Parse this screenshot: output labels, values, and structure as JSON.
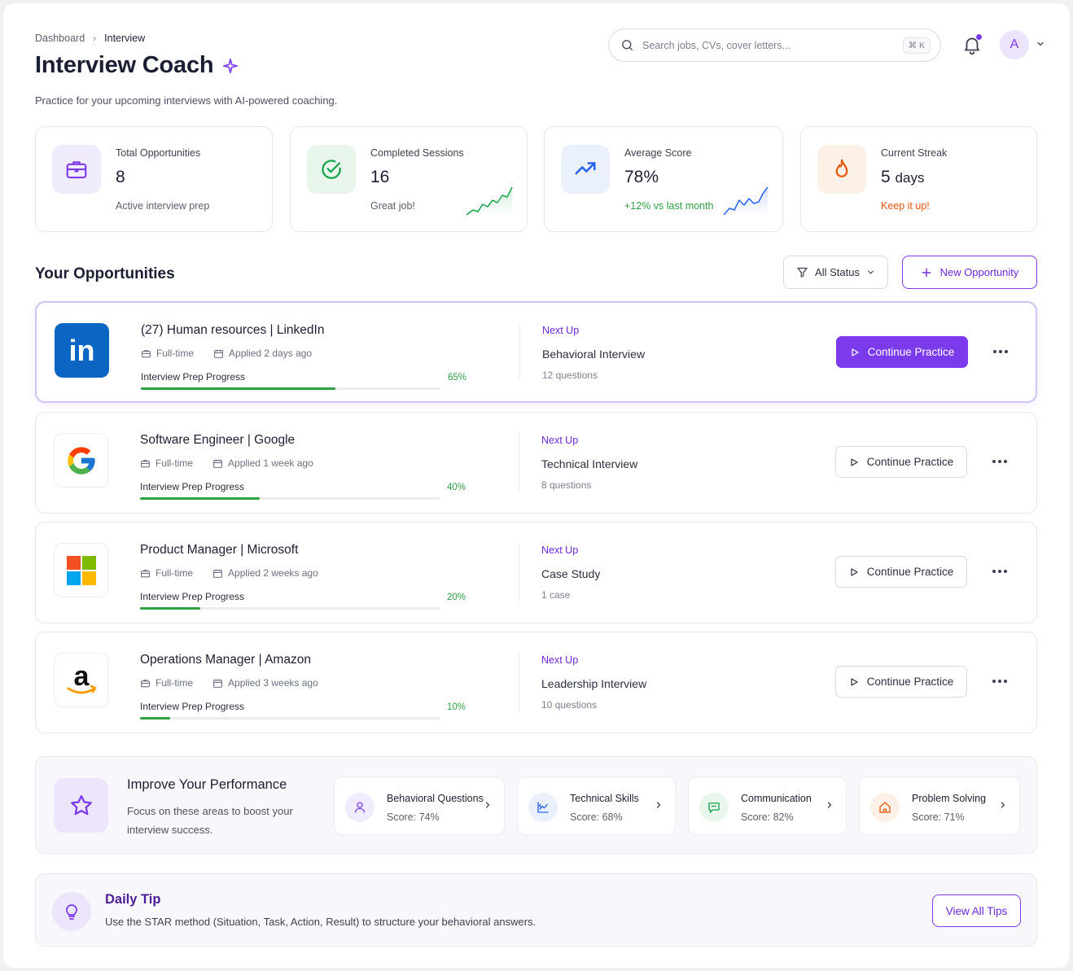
{
  "breadcrumb": {
    "root": "Dashboard",
    "separator": "›",
    "current": "Interview"
  },
  "header": {
    "title": "Interview Coach",
    "subtitle": "Practice for your upcoming interviews with AI-powered coaching.",
    "search_placeholder": "Search jobs, CVs, cover letters...",
    "search_shortcut": "⌘ K",
    "avatar_initial": "A"
  },
  "stats": [
    {
      "label": "Total Opportunities",
      "value": "8",
      "note": "Active interview prep",
      "icon": "briefcase-icon",
      "color": "#7c3aed"
    },
    {
      "label": "Completed Sessions",
      "value": "16",
      "note": "Great job!",
      "icon": "check-circle-icon",
      "color": "#16a34a"
    },
    {
      "label": "Average Score",
      "value": "78%",
      "note": "+12% vs last month",
      "icon": "trending-up-icon",
      "color": "#2563eb"
    },
    {
      "label": "Current Streak",
      "value": "5",
      "value_unit": "days",
      "note": "Keep it up!",
      "icon": "flame-icon",
      "color": "#ea580c"
    }
  ],
  "opportunities": {
    "title": "Your Opportunities",
    "filter_label": "All Status",
    "new_label": "New Opportunity",
    "continue_label": "Continue Practice",
    "next_label": "Next Up",
    "progress_label": "Interview Prep Progress",
    "items": [
      {
        "title": "(27) Human resources | LinkedIn",
        "type": "Full-time",
        "applied": "Applied 2 days ago",
        "progress": 65,
        "progress_text": "65%",
        "next": "Behavioral Interview",
        "count": "12 questions",
        "logo": "linkedin-logo"
      },
      {
        "title": "Software Engineer | Google",
        "type": "Full-time",
        "applied": "Applied 1 week ago",
        "progress": 40,
        "progress_text": "40%",
        "next": "Technical Interview",
        "count": "8 questions",
        "logo": "google-logo"
      },
      {
        "title": "Product Manager | Microsoft",
        "type": "Full-time",
        "applied": "Applied 2 weeks ago",
        "progress": 20,
        "progress_text": "20%",
        "next": "Case Study",
        "count": "1 case",
        "logo": "microsoft-logo"
      },
      {
        "title": "Operations Manager | Amazon",
        "type": "Full-time",
        "applied": "Applied 3 weeks ago",
        "progress": 10,
        "progress_text": "10%",
        "next": "Leadership Interview",
        "count": "10 questions",
        "logo": "amazon-logo"
      }
    ]
  },
  "improve": {
    "title": "Improve Your Performance",
    "description": "Focus on these areas to boost your interview success.",
    "areas": [
      {
        "name": "Behavioral Questions",
        "score": "Score: 74%",
        "icon": "person-icon",
        "color": "#7c3aed"
      },
      {
        "name": "Technical Skills",
        "score": "Score: 68%",
        "icon": "code-chart-icon",
        "color": "#2563eb"
      },
      {
        "name": "Communication",
        "score": "Score: 82%",
        "icon": "chat-icon",
        "color": "#16a34a"
      },
      {
        "name": "Problem Solving",
        "score": "Score: 71%",
        "icon": "home-icon",
        "color": "#ea580c"
      }
    ]
  },
  "tip": {
    "title": "Daily Tip",
    "text": "Use the STAR method (Situation, Task, Action, Result) to structure your behavioral answers.",
    "button": "View All Tips"
  },
  "colors": {
    "accent": "#7c3aed",
    "success": "#2f9e44",
    "warning": "#ea580c",
    "info": "#2563eb"
  }
}
